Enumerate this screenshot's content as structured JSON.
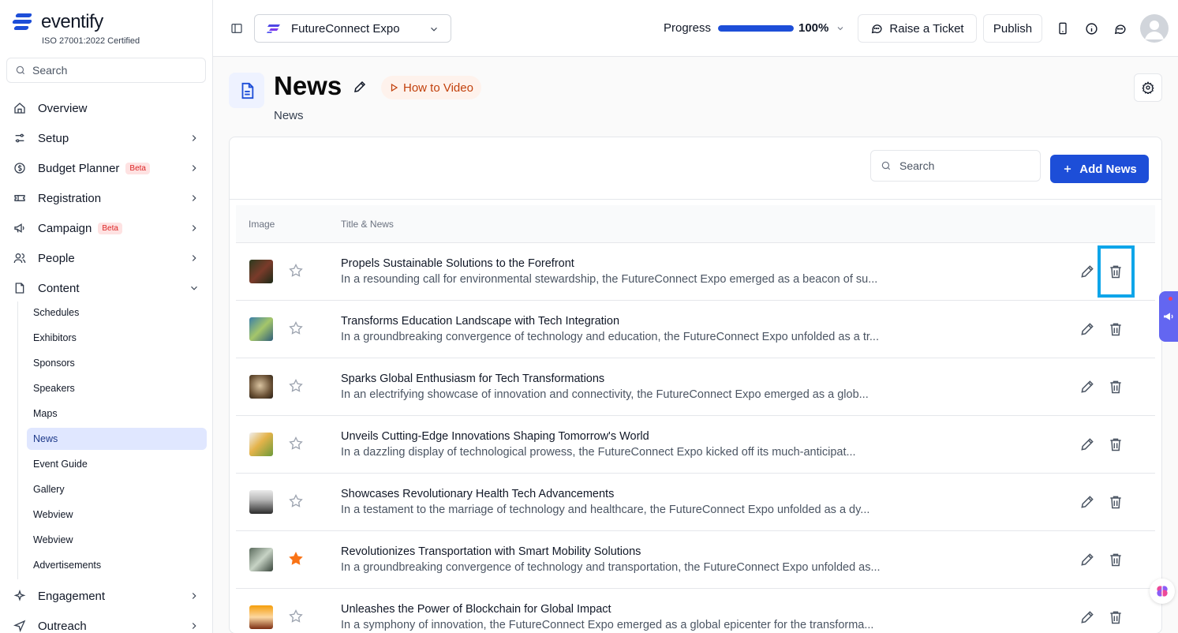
{
  "brand": {
    "name": "eventify",
    "certification": "ISO 27001:2022 Certified"
  },
  "sidebar": {
    "search_placeholder": "Search",
    "items": [
      {
        "label": "Overview",
        "icon": "home-icon"
      },
      {
        "label": "Setup",
        "icon": "sliders-icon"
      },
      {
        "label": "Budget Planner",
        "icon": "dollar-icon",
        "badge": "Beta"
      },
      {
        "label": "Registration",
        "icon": "ticket-icon"
      },
      {
        "label": "Campaign",
        "icon": "megaphone-icon",
        "badge": "Beta"
      },
      {
        "label": "People",
        "icon": "users-icon"
      },
      {
        "label": "Content",
        "icon": "content-icon",
        "expanded": true
      },
      {
        "label": "Engagement",
        "icon": "sparkle-icon"
      },
      {
        "label": "Outreach",
        "icon": "send-icon"
      }
    ],
    "content_subitems": [
      "Schedules",
      "Exhibitors",
      "Sponsors",
      "Speakers",
      "Maps",
      "News",
      "Event Guide",
      "Gallery",
      "Webview",
      "Webview",
      "Advertisements"
    ],
    "active_subitem": "News"
  },
  "header": {
    "event_name": "FutureConnect Expo",
    "progress_label": "Progress",
    "progress_value": 100,
    "progress_text": "100%",
    "raise_ticket": "Raise a Ticket",
    "publish": "Publish"
  },
  "page": {
    "title": "News",
    "how_to": "How to Video",
    "subtitle": "News",
    "search_placeholder": "Search",
    "add_button": "Add News"
  },
  "table": {
    "columns": [
      "Image",
      "Title & News"
    ],
    "rows": [
      {
        "title": "Propels Sustainable Solutions to the Forefront",
        "desc": "In a resounding call for environmental stewardship, the FutureConnect Expo emerged as a beacon of su...",
        "starred": false
      },
      {
        "title": "Transforms Education Landscape with Tech Integration",
        "desc": "In a groundbreaking convergence of technology and education, the FutureConnect Expo unfolded as a tr...",
        "starred": false
      },
      {
        "title": "Sparks Global Enthusiasm for Tech Transformations",
        "desc": "In an electrifying showcase of innovation and connectivity, the FutureConnect Expo emerged as a glob...",
        "starred": false
      },
      {
        "title": "Unveils Cutting-Edge Innovations Shaping Tomorrow's World",
        "desc": "In a dazzling display of technological prowess, the FutureConnect Expo kicked off its much-anticipat...",
        "starred": false
      },
      {
        "title": "Showcases Revolutionary Health Tech Advancements",
        "desc": "In a testament to the marriage of technology and healthcare, the FutureConnect Expo unfolded as a dy...",
        "starred": false
      },
      {
        "title": "Revolutionizes Transportation with Smart Mobility Solutions",
        "desc": "In a groundbreaking convergence of technology and transportation, the FutureConnect Expo unfolded as...",
        "starred": true
      },
      {
        "title": "Unleashes the Power of Blockchain for Global Impact",
        "desc": "In a symphony of innovation, the FutureConnect Expo emerged as a global epicenter for the transforma...",
        "starred": false
      }
    ]
  },
  "colors": {
    "accent": "#1d4ed8",
    "star_active": "#f97316",
    "highlight": "#0ea5e9"
  }
}
